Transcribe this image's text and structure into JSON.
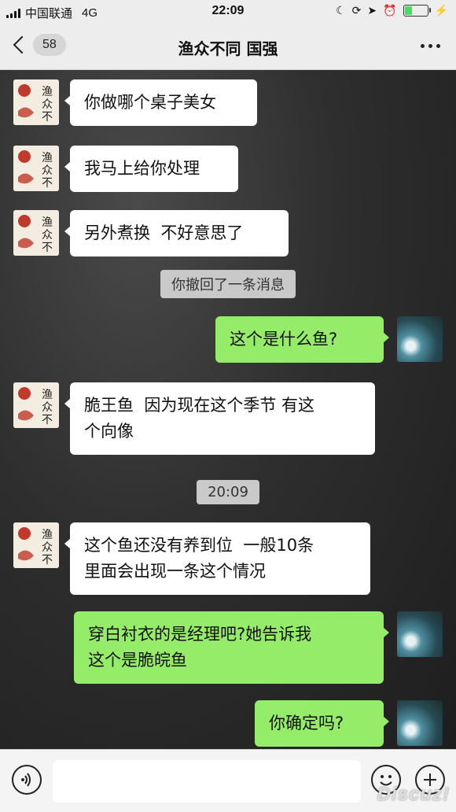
{
  "status_bar": {
    "carrier": "中国联通",
    "network": "4G",
    "time": "22:09"
  },
  "nav": {
    "back_badge": "58",
    "title": "渔众不同 国强"
  },
  "avatar_left_text": "渔众不同",
  "messages": [
    {
      "side": "left",
      "text": "你做哪个桌子美女"
    },
    {
      "side": "left",
      "text": "我马上给你处理"
    },
    {
      "side": "left",
      "text": "另外煮换  不好意思了"
    },
    {
      "side": "system",
      "text": "你撤回了一条消息"
    },
    {
      "side": "right",
      "text": "这个是什么鱼?"
    },
    {
      "side": "left",
      "text": "脆王鱼  因为现在这个季节 有这\n个向像"
    },
    {
      "side": "system",
      "text": "20:09"
    },
    {
      "side": "left",
      "text": "这个鱼还没有养到位  一般10条\n里面会出现一条这个情况"
    },
    {
      "side": "right",
      "text": "穿白衬衣的是经理吧?她告诉我\n这个是脆皖鱼"
    },
    {
      "side": "right",
      "text": "你确定吗?"
    }
  ],
  "input": {
    "placeholder": ""
  },
  "watermark": "Discuz!",
  "colors": {
    "sent_bubble": "#95ec69",
    "received_bubble": "#ffffff",
    "bar_bg": "#ededed"
  },
  "icons": {
    "voice": "voice-icon",
    "emoji": "emoji-icon",
    "add": "plus-icon"
  }
}
